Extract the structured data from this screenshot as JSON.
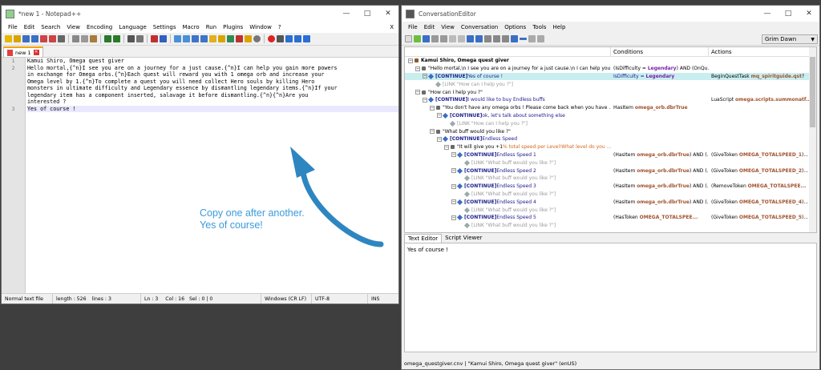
{
  "npp": {
    "title": "*new 1 - Notepad++",
    "menu": [
      "File",
      "Edit",
      "Search",
      "View",
      "Encoding",
      "Language",
      "Settings",
      "Macro",
      "Run",
      "Plugins",
      "Window",
      "?"
    ],
    "menu_close": "X",
    "tab": "new 1",
    "lines": [
      {
        "num": "1",
        "text": "Kamui Shiro, Omega quest giver"
      },
      {
        "num": "2",
        "text": "Hello mortal,{^n}I see you are on a journey for a just cause.{^n}I can help you gain more powers"
      },
      {
        "num": "",
        "text": "in exchange for Omega orbs.{^n}Each quest will reward you with 1 omega orb and increase your"
      },
      {
        "num": "",
        "text": "Omega level by 1.{^n}To complete a quest you will need collect Hero souls by killing Hero"
      },
      {
        "num": "",
        "text": "monsters in ultimate difficulty and Legendary essence by dismantling legendary items.{^n}If your"
      },
      {
        "num": "",
        "text": "legendary item has a component inserted, salavage it before dismantling.{^n}{^n}Are you"
      },
      {
        "num": "",
        "text": "interested ?"
      },
      {
        "num": "3",
        "text": "Yes of course !"
      }
    ],
    "status": {
      "type": "Normal text file",
      "length": "length : 526",
      "lines": "lines : 3",
      "pos": "Ln : 3",
      "col": "Col : 16",
      "sel": "Sel : 0 | 0",
      "eol": "Windows (CR LF)",
      "enc": "UTF-8",
      "mode": "INS"
    }
  },
  "annotation": {
    "line1": "Copy one after another.",
    "line2": "Yes of course!"
  },
  "ce": {
    "title": "ConversationEditor",
    "menu": [
      "File",
      "Edit",
      "View",
      "Conversation",
      "Options",
      "Tools",
      "Help"
    ],
    "dropdown": "Grim Dawn",
    "columns": {
      "conditions": "Conditions",
      "actions": "Actions"
    },
    "tree": [
      {
        "indent": 0,
        "parts": [
          {
            "t": "Kamui Shiro, Omega quest giver",
            "c": "#000",
            "b": true
          }
        ],
        "cond": [],
        "act": [],
        "icon": "npc"
      },
      {
        "indent": 1,
        "parts": [
          {
            "t": "\"Hello mortal,\\n I see you are on a journey for a just cause.\\n I can help you...",
            "c": "#000"
          }
        ],
        "cond": [
          {
            "t": "(IsDifficulty = ",
            "c": "#000"
          },
          {
            "t": "Legendary",
            "c": "#7a1fa2",
            "b": true
          },
          {
            "t": ") AND (OnQu...",
            "c": "#000"
          }
        ],
        "act": [],
        "icon": "q"
      },
      {
        "indent": 2,
        "parts": [
          {
            "t": "[CONTINUE]",
            "c": "#1b1b8a",
            "b": true
          },
          {
            "t": " Yes of course !",
            "c": "#1b1b8a"
          }
        ],
        "cond": [
          {
            "t": "IsDifficulty = ",
            "c": "#1b1b8a"
          },
          {
            "t": "Legendary",
            "c": "#7a1fa2",
            "b": true
          }
        ],
        "act": [
          {
            "t": "BeginQuestTask ",
            "c": "#000"
          },
          {
            "t": "mq_spiritguide.qst",
            "c": "#a0522d",
            "b": true
          },
          {
            "t": "?",
            "c": "#000"
          }
        ],
        "icon": "a",
        "sel": true
      },
      {
        "indent": 3,
        "parts": [
          {
            "t": "[LINK \"How can I help you ?\"]",
            "c": "#999"
          }
        ],
        "cond": [],
        "act": [],
        "icon": "l"
      },
      {
        "indent": 1,
        "parts": [
          {
            "t": "\"How can I help you ?\"",
            "c": "#000"
          }
        ],
        "cond": [],
        "act": [],
        "icon": "q"
      },
      {
        "indent": 2,
        "parts": [
          {
            "t": "[CONTINUE]",
            "c": "#1b1b8a",
            "b": true
          },
          {
            "t": " I would like to buy Endless buffs",
            "c": "#1b1b8a"
          }
        ],
        "cond": [],
        "act": [
          {
            "t": "LuaScript ",
            "c": "#000"
          },
          {
            "t": "omega.scripts.summonatf...",
            "c": "#a0522d",
            "b": true
          }
        ],
        "icon": "a"
      },
      {
        "indent": 3,
        "parts": [
          {
            "t": "\"You don't have any omega orbs ! Please come back when you have ...",
            "c": "#000"
          }
        ],
        "cond": [
          {
            "t": "HasItem ",
            "c": "#000"
          },
          {
            "t": "omega_orb.dbrTrue",
            "c": "#a0522d",
            "b": true
          }
        ],
        "act": [],
        "icon": "q"
      },
      {
        "indent": 4,
        "parts": [
          {
            "t": "[CONTINUE]",
            "c": "#1b1b8a",
            "b": true
          },
          {
            "t": " ok, let's talk about something else",
            "c": "#1b1b8a"
          }
        ],
        "cond": [],
        "act": [],
        "icon": "a"
      },
      {
        "indent": 5,
        "parts": [
          {
            "t": "[LINK \"How can I help you ?\"]",
            "c": "#999"
          }
        ],
        "cond": [],
        "act": [],
        "icon": "l"
      },
      {
        "indent": 3,
        "parts": [
          {
            "t": "\"What buff would you like ?\"",
            "c": "#000"
          }
        ],
        "cond": [],
        "act": [],
        "icon": "q"
      },
      {
        "indent": 4,
        "parts": [
          {
            "t": "[CONTINUE]",
            "c": "#1b1b8a",
            "b": true
          },
          {
            "t": " Endless Speed",
            "c": "#1b1b8a"
          }
        ],
        "cond": [],
        "act": [],
        "icon": "a"
      },
      {
        "indent": 5,
        "parts": [
          {
            "t": "\"It will give you +1",
            "c": "#000"
          },
          {
            "t": "% total speed per Level!What level do you ...",
            "c": "#d2691e"
          }
        ],
        "cond": [],
        "act": [],
        "icon": "q"
      },
      {
        "indent": 6,
        "parts": [
          {
            "t": "[CONTINUE]",
            "c": "#1b1b8a",
            "b": true
          },
          {
            "t": " Endless Speed 1",
            "c": "#1b1b8a"
          }
        ],
        "cond": [
          {
            "t": "(HasItem ",
            "c": "#000"
          },
          {
            "t": "omega_orb.dbrTrue",
            "c": "#a0522d",
            "b": true
          },
          {
            "t": ") AND (...",
            "c": "#000"
          }
        ],
        "act": [
          {
            "t": "(GiveToken ",
            "c": "#000"
          },
          {
            "t": "OMEGA_TOTALSPEED_1",
            "c": "#a0522d",
            "b": true
          },
          {
            "t": ")...",
            "c": "#000"
          }
        ],
        "icon": "a"
      },
      {
        "indent": 7,
        "parts": [
          {
            "t": "[LINK \"What buff would you like ?\"]",
            "c": "#999"
          }
        ],
        "cond": [],
        "act": [],
        "icon": "l"
      },
      {
        "indent": 6,
        "parts": [
          {
            "t": "[CONTINUE]",
            "c": "#1b1b8a",
            "b": true
          },
          {
            "t": " Endless Speed 2",
            "c": "#1b1b8a"
          }
        ],
        "cond": [
          {
            "t": "(HasItem ",
            "c": "#000"
          },
          {
            "t": "omega_orb.dbrTrue",
            "c": "#a0522d",
            "b": true
          },
          {
            "t": ") AND (...",
            "c": "#000"
          }
        ],
        "act": [
          {
            "t": "(GiveToken ",
            "c": "#000"
          },
          {
            "t": "OMEGA_TOTALSPEED_2",
            "c": "#a0522d",
            "b": true
          },
          {
            "t": ")...",
            "c": "#000"
          }
        ],
        "icon": "a"
      },
      {
        "indent": 7,
        "parts": [
          {
            "t": "[LINK \"What buff would you like ?\"]",
            "c": "#999"
          }
        ],
        "cond": [],
        "act": [],
        "icon": "l"
      },
      {
        "indent": 6,
        "parts": [
          {
            "t": "[CONTINUE]",
            "c": "#1b1b8a",
            "b": true
          },
          {
            "t": " Endless Speed 3",
            "c": "#1b1b8a"
          }
        ],
        "cond": [
          {
            "t": "(HasItem ",
            "c": "#000"
          },
          {
            "t": "omega_orb.dbrTrue",
            "c": "#a0522d",
            "b": true
          },
          {
            "t": ") AND (...",
            "c": "#000"
          }
        ],
        "act": [
          {
            "t": "(RemoveToken ",
            "c": "#000"
          },
          {
            "t": "OMEGA_TOTALSPEE...",
            "c": "#a0522d",
            "b": true
          }
        ],
        "icon": "a"
      },
      {
        "indent": 7,
        "parts": [
          {
            "t": "[LINK \"What buff would you like ?\"]",
            "c": "#999"
          }
        ],
        "cond": [],
        "act": [],
        "icon": "l"
      },
      {
        "indent": 6,
        "parts": [
          {
            "t": "[CONTINUE]",
            "c": "#1b1b8a",
            "b": true
          },
          {
            "t": " Endless Speed 4",
            "c": "#1b1b8a"
          }
        ],
        "cond": [
          {
            "t": "(HasItem ",
            "c": "#000"
          },
          {
            "t": "omega_orb.dbrTrue",
            "c": "#a0522d",
            "b": true
          },
          {
            "t": ") AND (...",
            "c": "#000"
          }
        ],
        "act": [
          {
            "t": "(GiveToken ",
            "c": "#000"
          },
          {
            "t": "OMEGA_TOTALSPEED_4",
            "c": "#a0522d",
            "b": true
          },
          {
            "t": ")...",
            "c": "#000"
          }
        ],
        "icon": "a"
      },
      {
        "indent": 7,
        "parts": [
          {
            "t": "[LINK \"What buff would you like ?\"]",
            "c": "#999"
          }
        ],
        "cond": [],
        "act": [],
        "icon": "l"
      },
      {
        "indent": 6,
        "parts": [
          {
            "t": "[CONTINUE]",
            "c": "#1b1b8a",
            "b": true
          },
          {
            "t": " Endless Speed 5",
            "c": "#1b1b8a"
          }
        ],
        "cond": [
          {
            "t": "(HasToken ",
            "c": "#000"
          },
          {
            "t": "OMEGA_TOTALSPEE...",
            "c": "#a0522d",
            "b": true
          }
        ],
        "act": [
          {
            "t": "(GiveToken ",
            "c": "#000"
          },
          {
            "t": "OMEGA_TOTALSPEED_5",
            "c": "#a0522d",
            "b": true
          },
          {
            "t": ")...",
            "c": "#000"
          }
        ],
        "icon": "a"
      },
      {
        "indent": 7,
        "parts": [
          {
            "t": "[LINK \"What buff would you like ?\"]",
            "c": "#999"
          }
        ],
        "cond": [],
        "act": [],
        "icon": "l"
      }
    ],
    "tabs": [
      "Text Editor",
      "Script Viewer"
    ],
    "editor_text": "Yes of course !",
    "status": "omega_questgiver.cnv | \"Kamui Shiro, Omega quest giver\" (enUS)"
  }
}
